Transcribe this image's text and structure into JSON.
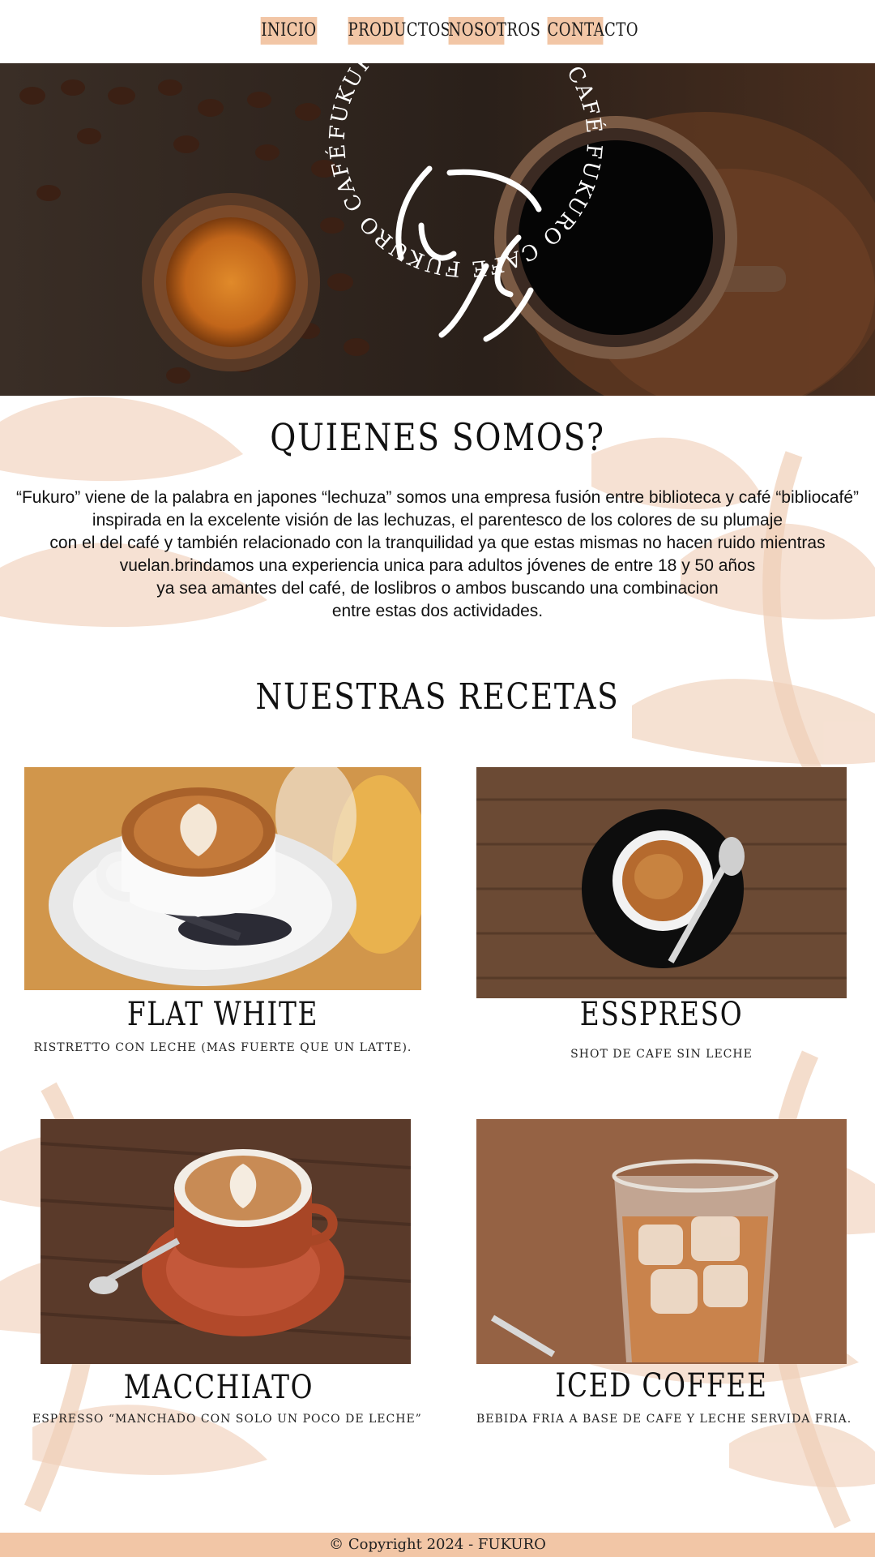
{
  "nav": {
    "items": [
      {
        "label": "INICIO"
      },
      {
        "label": "PRODUCTOS"
      },
      {
        "label": "NOSOTROS"
      },
      {
        "label": "CONTACTO"
      }
    ]
  },
  "hero": {
    "logo_ring_text": "FUKURO CAFÉ  FUKURO CAFÉ  FUKURO CAFÉ  FUKURO CAFÉ  FUKURO CAFÉ"
  },
  "about": {
    "title": "QUIENES SOMOS?",
    "lines": [
      "“Fukuro” viene de la palabra en japones “lechuza” somos una empresa fusión entre biblioteca y café “bibliocafé”",
      "inspirada en la excelente visión de las lechuzas, el parentesco de los colores de su plumaje",
      "con el del café y también relacionado con la tranquilidad ya que estas mismas no hacen ruido mientras",
      "vuelan.brindamos una experiencia unica para adultos jóvenes de entre 18 y 50 años",
      "ya sea amantes del café, de loslibros o ambos buscando una combinacion",
      "entre estas dos actividades."
    ]
  },
  "recipes": {
    "title": "NUESTRAS RECETAS",
    "items": [
      {
        "name": "FLAT WHITE",
        "desc": "RISTRETTO CON LECHE (MAS FUERTE QUE UN LATTE)."
      },
      {
        "name": "ESSPRESO",
        "desc": "SHOT DE CAFE SIN LECHE"
      },
      {
        "name": "MACCHIATO",
        "desc": "ESPRESSO “MANCHADO CON SOLO UN POCO DE LECHE”"
      },
      {
        "name": "ICED COFFEE",
        "desc": "BEBIDA FRIA A BASE DE CAFE Y LECHE SERVIDA FRIA."
      }
    ]
  },
  "footer": {
    "text": "© Copyright 2024 - FUKURO"
  },
  "colors": {
    "accent": "#f2c6a6",
    "deco": "#f4dccb"
  }
}
